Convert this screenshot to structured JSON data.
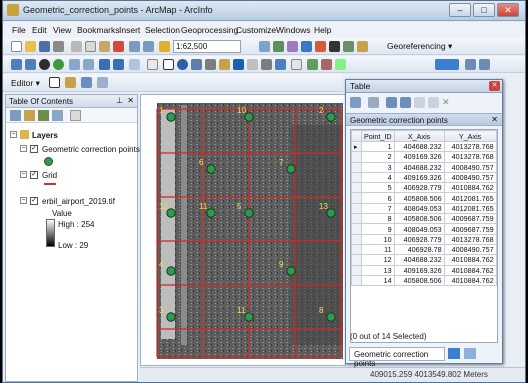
{
  "window": {
    "title": "Geometric_correction_points - ArcMap - ArcInfo",
    "min": "–",
    "max": "□",
    "close": "✕"
  },
  "menu": [
    "File",
    "Edit",
    "View",
    "Bookmarks",
    "Insert",
    "Selection",
    "Geoprocessing",
    "Customize",
    "Windows",
    "Help"
  ],
  "toolbar": {
    "scale": "1:62,500",
    "georeferencing": "Georeferencing ▾",
    "editor": "Editor ▾"
  },
  "toc": {
    "title": "Table Of Contents",
    "layers_label": "Layers",
    "items": [
      "Geometric correction points",
      "Grid",
      "erbil_airport_2019.tif"
    ],
    "value_label": "Value",
    "high": "High : 254",
    "low": "Low : 29"
  },
  "map": {
    "points": [
      {
        "label": "1"
      },
      {
        "label": "10"
      },
      {
        "label": "2"
      },
      {
        "label": "6"
      },
      {
        "label": "7"
      },
      {
        "label": "12"
      },
      {
        "label": "13"
      },
      {
        "label": "5"
      },
      {
        "label": "11"
      },
      {
        "label": "4"
      },
      {
        "label": "9"
      },
      {
        "label": "3"
      },
      {
        "label": "11"
      },
      {
        "label": "8"
      }
    ]
  },
  "table": {
    "window_title": "Table",
    "tab_header": "Geometric correction points",
    "columns": [
      "Point_ID",
      "X_Axis",
      "Y_Axis"
    ],
    "rows": [
      [
        "1",
        "404688.232",
        "4013278.768"
      ],
      [
        "2",
        "409169.326",
        "4013278.768"
      ],
      [
        "3",
        "404688.232",
        "4008490.757"
      ],
      [
        "4",
        "409169.326",
        "4008490.757"
      ],
      [
        "5",
        "406928.779",
        "4010884.762"
      ],
      [
        "6",
        "405808.506",
        "4012081.765"
      ],
      [
        "7",
        "408049.053",
        "4012081.765"
      ],
      [
        "8",
        "405808.506",
        "4009687.759"
      ],
      [
        "9",
        "408049.053",
        "4009687.759"
      ],
      [
        "10",
        "406928.779",
        "4013278.768"
      ],
      [
        "11",
        "406928.78",
        "4008490.757"
      ],
      [
        "12",
        "404688.232",
        "4010884.762"
      ],
      [
        "13",
        "409169.326",
        "4010884.762"
      ],
      [
        "14",
        "405808.506",
        "4010884.762"
      ]
    ],
    "nav_page": "1",
    "selection_status": "(0 out of 14 Selected)",
    "bottom_tab": "Geometric correction points"
  },
  "status": {
    "coords": "409015.259  4013549.802 Meters"
  }
}
